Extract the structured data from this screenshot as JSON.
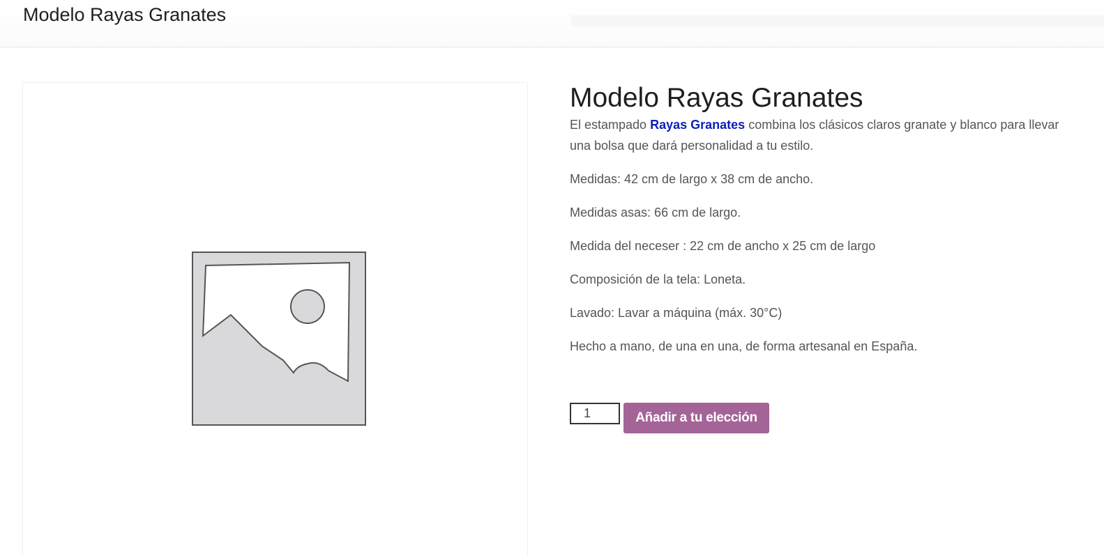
{
  "header": {
    "title": "Modelo Rayas Granates"
  },
  "product": {
    "title": "Modelo Rayas Granates",
    "intro": {
      "before": "El estampado ",
      "link": "Rayas Granates",
      "after": " combina los clásicos  claros granate y blanco  para llevar una bolsa que dará personalidad a tu estilo."
    },
    "details": [
      "Medidas: 42 cm de largo x 38 cm de ancho.",
      "Medidas asas: 66 cm de largo.",
      "Medida del neceser : 22 cm de ancho x  25 cm  de largo",
      "Composición de la tela: Loneta.",
      "Lavado: Lavar a máquina (máx. 30°C)",
      "Hecho a mano, de una en una, de forma artesanal en España."
    ],
    "image_icon": "image-placeholder-icon"
  },
  "cart": {
    "quantity": "1",
    "add_label": "Añadir a tu elección"
  },
  "colors": {
    "button": "#a46497",
    "link": "#0a1fb8"
  }
}
